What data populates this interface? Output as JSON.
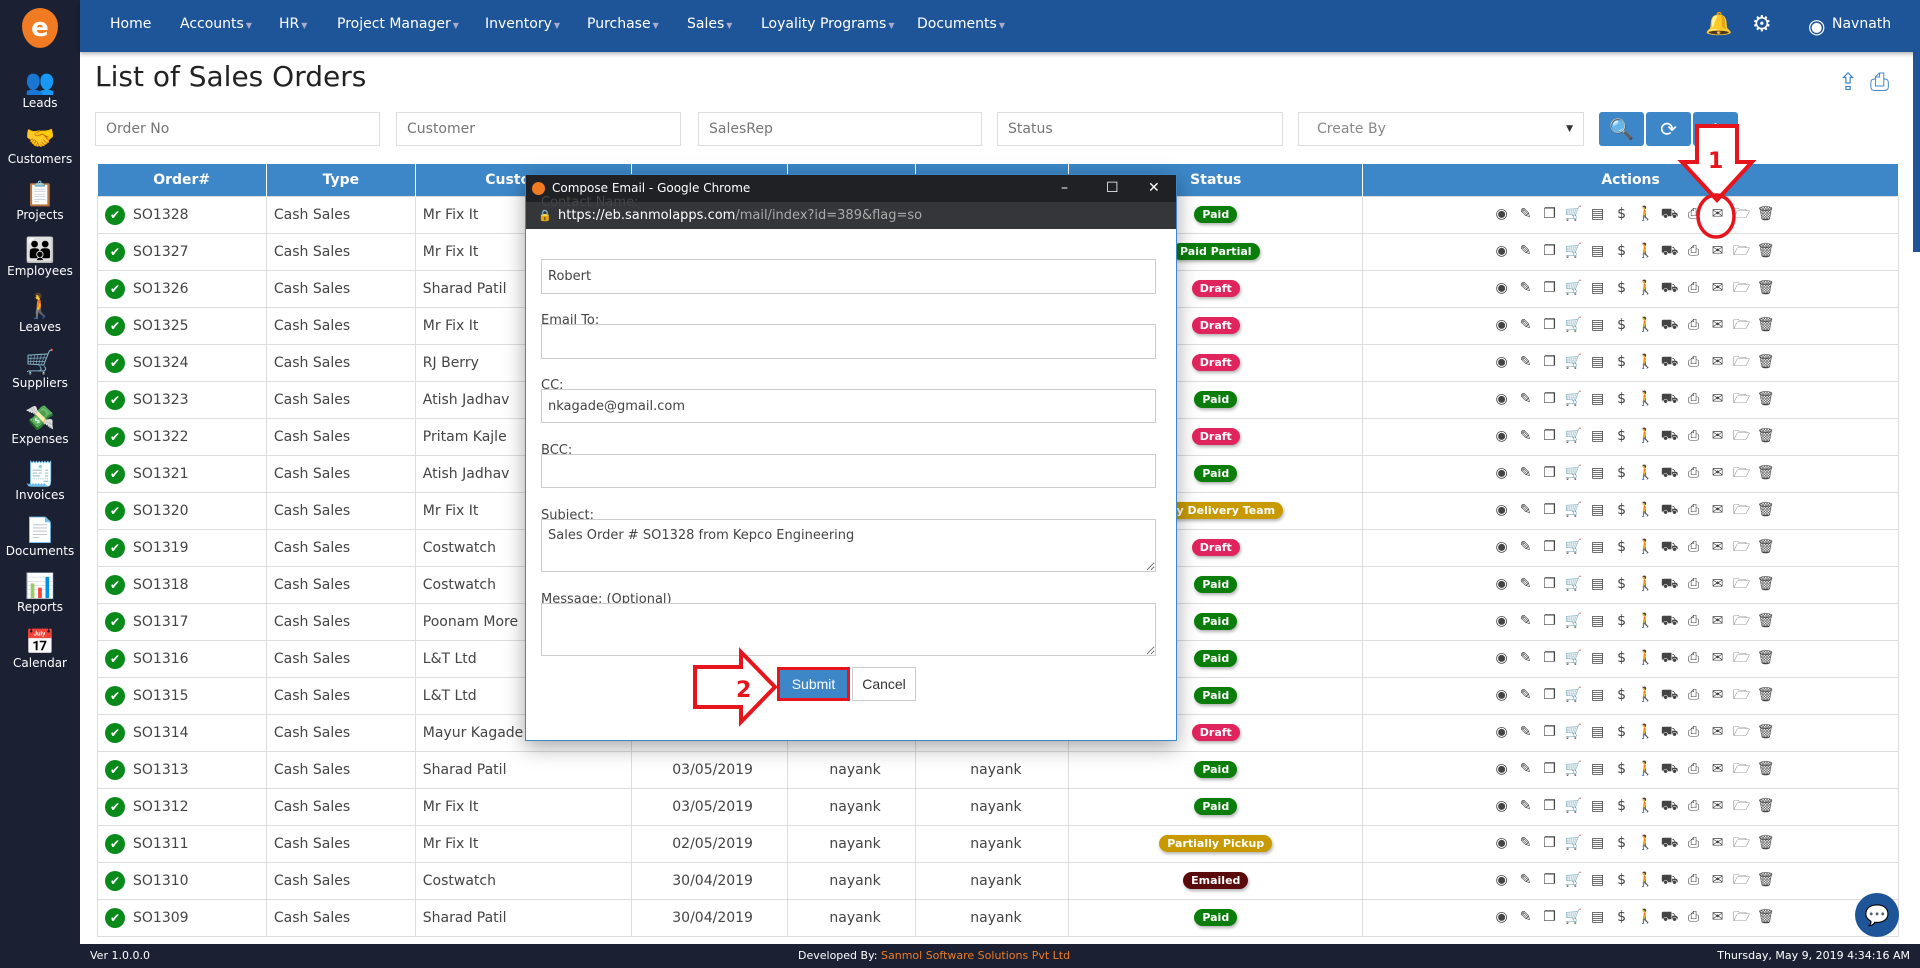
{
  "sidebar": {
    "items": [
      {
        "label": "Leads",
        "icon": "leads-icon",
        "glyph": "👥"
      },
      {
        "label": "Customers",
        "icon": "customers-icon",
        "glyph": "🤝"
      },
      {
        "label": "Projects",
        "icon": "projects-icon",
        "glyph": "📋"
      },
      {
        "label": "Employees",
        "icon": "employees-icon",
        "glyph": "👪"
      },
      {
        "label": "Leaves",
        "icon": "leaves-icon",
        "glyph": "🚶"
      },
      {
        "label": "Suppliers",
        "icon": "suppliers-icon",
        "glyph": "🛒"
      },
      {
        "label": "Expenses",
        "icon": "expenses-icon",
        "glyph": "💸"
      },
      {
        "label": "Invoices",
        "icon": "invoices-icon",
        "glyph": "🧾"
      },
      {
        "label": "Documents",
        "icon": "documents-icon",
        "glyph": "📄"
      },
      {
        "label": "Reports",
        "icon": "reports-icon",
        "glyph": "📊"
      },
      {
        "label": "Calendar",
        "icon": "calendar-icon",
        "glyph": "📅"
      }
    ]
  },
  "nav": {
    "items": [
      "Home",
      "Accounts",
      "HR",
      "Project Manager",
      "Inventory",
      "Purchase",
      "Sales",
      "Loyality Programs",
      "Documents"
    ],
    "user": "Navnath"
  },
  "page": {
    "title": "List of Sales Orders"
  },
  "filters": {
    "order_no": "Order No",
    "customer": "Customer",
    "salesrep": "SalesRep",
    "status": "Status",
    "create_by": "Create By"
  },
  "table": {
    "headers": [
      "Order#",
      "Type",
      "Customer",
      "",
      "",
      "",
      "Status",
      "Actions"
    ],
    "rows": [
      {
        "order": "SO1328",
        "type": "Cash Sales",
        "customer": "Mr Fix It",
        "date": "",
        "rep": "",
        "by": "",
        "status": "Paid",
        "color": "#0a7d0a"
      },
      {
        "order": "SO1327",
        "type": "Cash Sales",
        "customer": "Mr Fix It",
        "date": "",
        "rep": "",
        "by": "",
        "status": "Paid Partial",
        "color": "#0a7d0a"
      },
      {
        "order": "SO1326",
        "type": "Cash Sales",
        "customer": "Sharad Patil",
        "date": "",
        "rep": "",
        "by": "",
        "status": "Draft",
        "color": "#e0245e"
      },
      {
        "order": "SO1325",
        "type": "Cash Sales",
        "customer": "Mr Fix It",
        "date": "",
        "rep": "",
        "by": "",
        "status": "Draft",
        "color": "#e0245e"
      },
      {
        "order": "SO1324",
        "type": "Cash Sales",
        "customer": "RJ Berry",
        "date": "",
        "rep": "",
        "by": "",
        "status": "Draft",
        "color": "#e0245e"
      },
      {
        "order": "SO1323",
        "type": "Cash Sales",
        "customer": "Atish Jadhav",
        "date": "",
        "rep": "",
        "by": "",
        "status": "Paid",
        "color": "#0a7d0a"
      },
      {
        "order": "SO1322",
        "type": "Cash Sales",
        "customer": "Pritam Kajle",
        "date": "",
        "rep": "",
        "by": "",
        "status": "Draft",
        "color": "#e0245e"
      },
      {
        "order": "SO1321",
        "type": "Cash Sales",
        "customer": "Atish Jadhav",
        "date": "",
        "rep": "",
        "by": "",
        "status": "Paid",
        "color": "#0a7d0a"
      },
      {
        "order": "SO1320",
        "type": "Cash Sales",
        "customer": "Mr Fix It",
        "date": "",
        "rep": "",
        "by": "",
        "status": "d By Delivery Team",
        "color": "#c89a00"
      },
      {
        "order": "SO1319",
        "type": "Cash Sales",
        "customer": "Costwatch",
        "date": "",
        "rep": "",
        "by": "",
        "status": "Draft",
        "color": "#e0245e"
      },
      {
        "order": "SO1318",
        "type": "Cash Sales",
        "customer": "Costwatch",
        "date": "",
        "rep": "",
        "by": "",
        "status": "Paid",
        "color": "#0a7d0a"
      },
      {
        "order": "SO1317",
        "type": "Cash Sales",
        "customer": "Poonam More",
        "date": "",
        "rep": "",
        "by": "",
        "status": "Paid",
        "color": "#0a7d0a"
      },
      {
        "order": "SO1316",
        "type": "Cash Sales",
        "customer": "L&T Ltd",
        "date": "",
        "rep": "",
        "by": "",
        "status": "Paid",
        "color": "#0a7d0a"
      },
      {
        "order": "SO1315",
        "type": "Cash Sales",
        "customer": "L&T Ltd",
        "date": "",
        "rep": "",
        "by": "",
        "status": "Paid",
        "color": "#0a7d0a"
      },
      {
        "order": "SO1314",
        "type": "Cash Sales",
        "customer": "Mayur Kagade",
        "date": "",
        "rep": "",
        "by": "",
        "status": "Draft",
        "color": "#e0245e"
      },
      {
        "order": "SO1313",
        "type": "Cash Sales",
        "customer": "Sharad Patil",
        "date": "03/05/2019",
        "rep": "nayank",
        "by": "nayank",
        "status": "Paid",
        "color": "#0a7d0a"
      },
      {
        "order": "SO1312",
        "type": "Cash Sales",
        "customer": "Mr Fix It",
        "date": "03/05/2019",
        "rep": "nayank",
        "by": "nayank",
        "status": "Paid",
        "color": "#0a7d0a"
      },
      {
        "order": "SO1311",
        "type": "Cash Sales",
        "customer": "Mr Fix It",
        "date": "02/05/2019",
        "rep": "nayank",
        "by": "nayank",
        "status": "Partially Pickup",
        "color": "#c89a00"
      },
      {
        "order": "SO1310",
        "type": "Cash Sales",
        "customer": "Costwatch",
        "date": "30/04/2019",
        "rep": "nayank",
        "by": "nayank",
        "status": "Emailed",
        "color": "#5a0a0a"
      },
      {
        "order": "SO1309",
        "type": "Cash Sales",
        "customer": "Sharad Patil",
        "date": "30/04/2019",
        "rep": "nayank",
        "by": "nayank",
        "status": "Paid",
        "color": "#0a7d0a"
      }
    ],
    "actions": [
      {
        "name": "view-icon",
        "g": "◉"
      },
      {
        "name": "edit-icon",
        "g": "✎"
      },
      {
        "name": "copy-icon",
        "g": "❐"
      },
      {
        "name": "cart-icon",
        "g": "🛒"
      },
      {
        "name": "invoice-icon",
        "g": "▤"
      },
      {
        "name": "payment-icon",
        "g": "$"
      },
      {
        "name": "pickup-icon",
        "g": "🚶"
      },
      {
        "name": "delivery-icon",
        "g": "⛟"
      },
      {
        "name": "print-icon",
        "g": "⎙"
      },
      {
        "name": "email-icon",
        "g": "✉"
      },
      {
        "name": "folder-icon",
        "g": "🗁"
      },
      {
        "name": "delete-icon",
        "g": "🗑"
      }
    ]
  },
  "dialog": {
    "title": "Compose Email - Google Chrome",
    "url_host": "https://eb.sanmolapps.com",
    "url_path": "/mail/index?id=389&flag=so",
    "contact_label": "Contact Name:",
    "contact_value": "Robert",
    "email_label": "Email To:",
    "email_value": "",
    "cc_label": "CC:",
    "cc_value": "nkagade@gmail.com",
    "bcc_label": "BCC:",
    "bcc_value": "",
    "subject_label": "Subject:",
    "subject_value": "Sales Order # SO1328 from Kepco Engineering",
    "message_label": "Message: (Optional)",
    "message_value": "",
    "submit": "Submit",
    "cancel": "Cancel"
  },
  "annotations": {
    "step1": "1",
    "step2": "2",
    "color": "#e8141c"
  },
  "footer": {
    "version": "Ver 1.0.0.0",
    "dev_label": "Developed By:",
    "dev_name": "Sanmol Software Solutions Pvt Ltd",
    "datetime": "Thursday, May 9, 2019 4:34:16 AM"
  }
}
